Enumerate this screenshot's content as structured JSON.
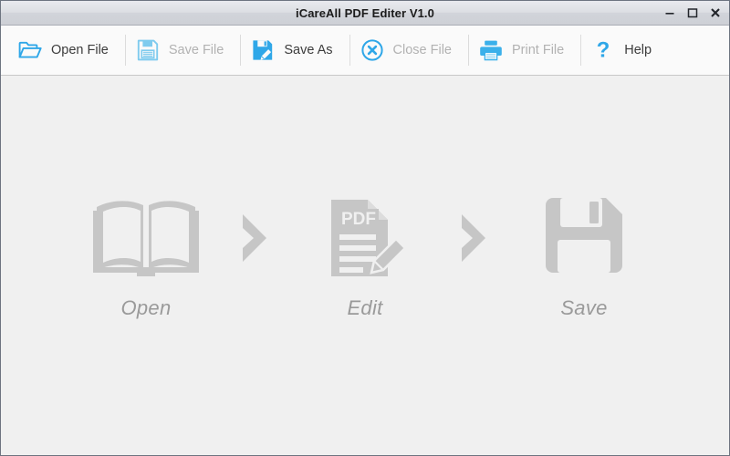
{
  "window": {
    "title": "iCareAll PDF Editer V1.0",
    "controls": {
      "minimize": "–",
      "maximize": "□",
      "close": "✕"
    }
  },
  "toolbar": {
    "items": [
      {
        "label": "Open File",
        "icon": "open-folder-icon",
        "enabled": true
      },
      {
        "label": "Save File",
        "icon": "floppy-disk-icon",
        "enabled": false
      },
      {
        "label": "Save As",
        "icon": "floppy-pencil-icon",
        "enabled": true
      },
      {
        "label": "Close File",
        "icon": "circle-x-icon",
        "enabled": false
      },
      {
        "label": "Print File",
        "icon": "printer-icon",
        "enabled": false
      },
      {
        "label": "Help",
        "icon": "question-mark-icon",
        "enabled": true
      }
    ]
  },
  "workflow": {
    "steps": [
      {
        "label": "Open",
        "icon": "open-book-icon"
      },
      {
        "label": "Edit",
        "icon": "pdf-document-pencil-icon",
        "badge": "PDF"
      },
      {
        "label": "Save",
        "icon": "floppy-disk-icon"
      }
    ],
    "arrows": [
      {
        "icon": "chevron-right-icon"
      },
      {
        "icon": "chevron-right-icon"
      }
    ]
  },
  "colors": {
    "accent_blue": "#2fa7e8",
    "accent_blue_disabled": "#7fcbee",
    "title_text": "#1b1b1b",
    "label_text": "#3c3c3c",
    "label_text_disabled": "#b2b2b2",
    "workflow_gray": "#c6c6c6",
    "workflow_label_gray": "#9a9a9a",
    "content_bg": "#f0f0f0",
    "toolbar_bg": "#fafafa"
  }
}
